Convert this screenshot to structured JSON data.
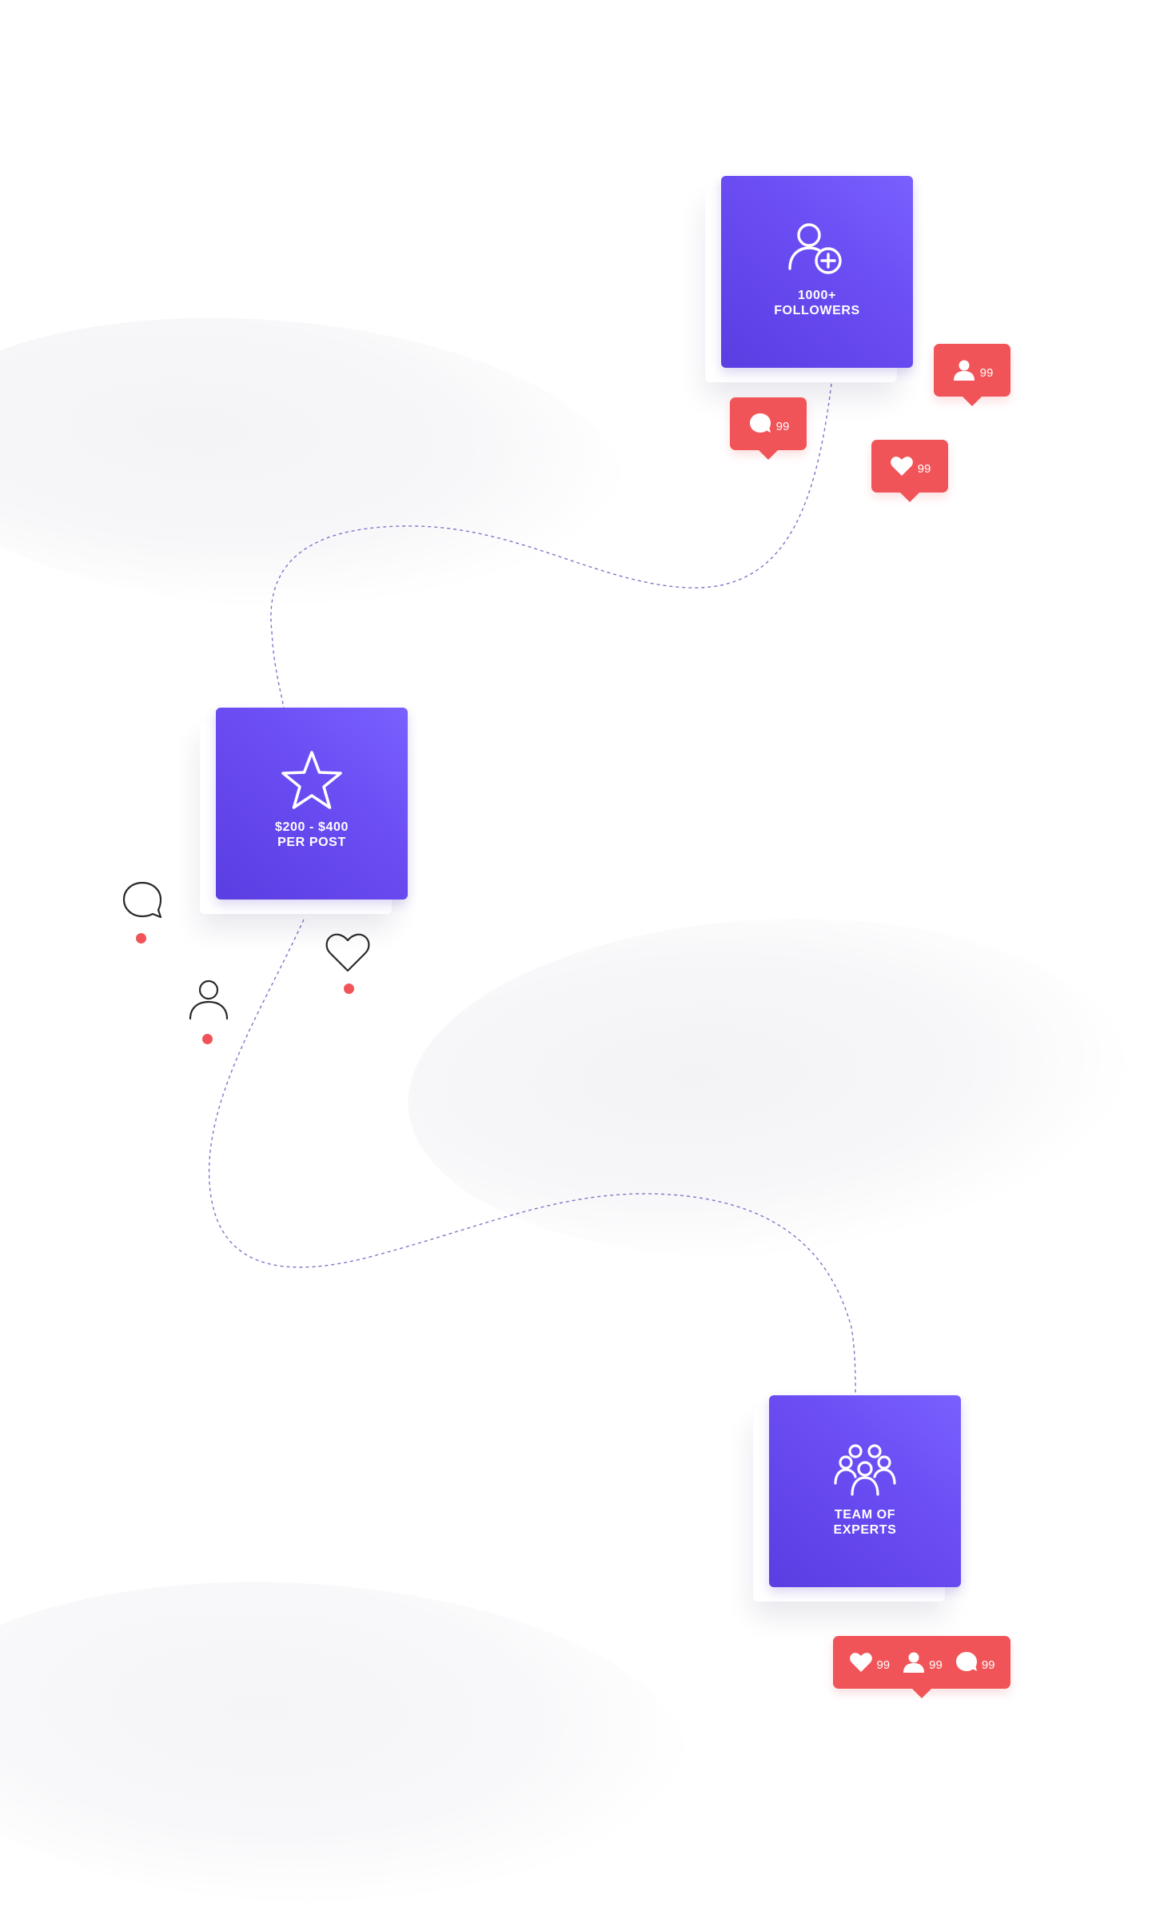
{
  "colors": {
    "card_gradient_start": "#7a60ff",
    "card_gradient_end": "#5b3ee2",
    "notification_red": "#f05458",
    "path_stroke": "#7d76c9",
    "outline_icon": "#2a2a2e"
  },
  "cards": [
    {
      "icon": "user-plus-icon",
      "line1": "1000+",
      "line2": "FOLLOWERS"
    },
    {
      "icon": "star-icon",
      "line1": "$200 - $400",
      "line2": "PER POST"
    },
    {
      "icon": "team-icon",
      "line1": "TEAM OF",
      "line2": "EXPERTS"
    }
  ],
  "notifications": {
    "comment": {
      "icon": "comment-bubble-icon",
      "count": "99"
    },
    "follower": {
      "icon": "user-icon",
      "count": "99"
    },
    "like": {
      "icon": "heart-icon",
      "count": "99"
    },
    "combined": {
      "like_count": "99",
      "follower_count": "99",
      "comment_count": "99"
    }
  },
  "floating_icons": [
    "comment-outline-icon",
    "user-outline-icon",
    "heart-outline-icon"
  ]
}
